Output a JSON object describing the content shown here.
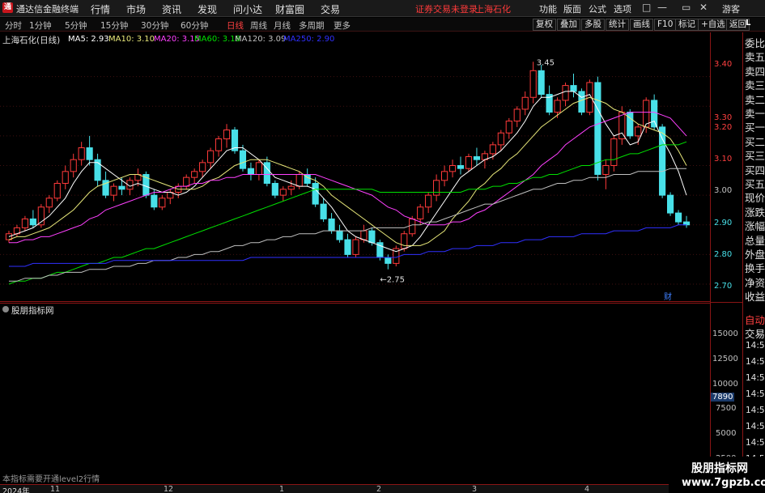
{
  "menubar": {
    "app_title": "通达信金融终端",
    "items": [
      "行情",
      "市场",
      "资讯",
      "发现",
      "问小达",
      "财富圈",
      "交易"
    ],
    "login_warning": "证券交易未登录",
    "stock_name": "上海石化",
    "right_items": [
      "功能",
      "版面",
      "公式",
      "选项"
    ],
    "guest": "游客",
    "window_controls": [
      "□",
      "—",
      "▭",
      "✕"
    ]
  },
  "toolbar": {
    "periods": [
      "分时",
      "1分钟",
      "5分钟",
      "15分钟",
      "30分钟",
      "60分钟",
      "日线",
      "周线",
      "月线",
      "多周期",
      "更多"
    ],
    "active_period": "日线",
    "buttons": [
      "复权",
      "叠加",
      "多股",
      "统计",
      "画线",
      "F10",
      "标记",
      "+自选",
      "返回"
    ]
  },
  "main_chart": {
    "title": "上海石化(日线)",
    "ma_labels": [
      {
        "text": "MA5: 2.93",
        "color": "#ffffff"
      },
      {
        "text": "MA10: 3.10",
        "color": "#e8e87a"
      },
      {
        "text": "MA20: 3.15",
        "color": "#ff40ff"
      },
      {
        "text": "MA60: 3.18",
        "color": "#00e000"
      },
      {
        "text": "MA120: 3.09",
        "color": "#c0c0c0"
      },
      {
        "text": "MA250: 2.90",
        "color": "#3030ff"
      }
    ],
    "high_label": "3.45",
    "low_label": "2.75",
    "y_ticks": [
      "3.40",
      "3.30",
      "3.20",
      "3.10",
      "3.00",
      "2.90",
      "2.80",
      "2.70"
    ],
    "fin_marker": "财"
  },
  "sub_chart": {
    "title": "股朋指标网",
    "y_ticks": [
      "15000",
      "12500",
      "10000",
      "7500",
      "5000",
      "2500"
    ],
    "current_value": "7890",
    "notice": "本指标需要开通level2行情"
  },
  "side_panel": {
    "rows": [
      "委比",
      "卖五",
      "卖四",
      "卖三",
      "卖二",
      "卖一",
      "买一",
      "买二",
      "买三",
      "买四",
      "买五",
      "现价",
      "涨跌",
      "涨幅",
      "总量",
      "外盘",
      "换手",
      "净资",
      "收益"
    ],
    "lower_rows": [
      "自动",
      "交易"
    ],
    "times": [
      "14:56",
      "14:56",
      "14:56",
      "14:56",
      "14:56",
      "14:56",
      "14:56",
      "14:56",
      "14:56",
      "14:56"
    ],
    "top_tag": "L"
  },
  "bottom_axis": {
    "labels": [
      "2024年",
      "11",
      "12",
      "1",
      "2",
      "3",
      "4"
    ]
  },
  "watermark": {
    "title": "股朋指标网",
    "url": "www.7gpzb.com"
  },
  "colors": {
    "up": "#ff3a3a",
    "down": "#48e0e8",
    "ma5": "#ffffff",
    "ma10": "#e8e87a",
    "ma20": "#ff40ff",
    "ma60": "#00e000",
    "ma120": "#c0c0c0",
    "ma250": "#3030ff"
  },
  "chart_data": {
    "type": "candlestick",
    "title": "上海石化(日线)",
    "y_range": [
      2.67,
      3.5
    ],
    "y_ticks": [
      3.4,
      3.3,
      3.2,
      3.1,
      3.0,
      2.9,
      2.8,
      2.7
    ],
    "candles": [
      [
        2.85,
        2.88,
        2.84,
        2.87
      ],
      [
        2.87,
        2.9,
        2.86,
        2.89
      ],
      [
        2.89,
        2.93,
        2.88,
        2.92
      ],
      [
        2.92,
        2.95,
        2.89,
        2.9
      ],
      [
        2.9,
        2.97,
        2.89,
        2.96
      ],
      [
        2.96,
        3.0,
        2.94,
        2.99
      ],
      [
        2.99,
        3.05,
        2.98,
        3.04
      ],
      [
        3.04,
        3.1,
        3.02,
        3.08
      ],
      [
        3.08,
        3.14,
        3.06,
        3.12
      ],
      [
        3.12,
        3.18,
        3.1,
        3.16
      ],
      [
        3.16,
        3.2,
        3.1,
        3.12
      ],
      [
        3.12,
        3.14,
        3.03,
        3.05
      ],
      [
        3.05,
        3.08,
        2.99,
        3.0
      ],
      [
        3.0,
        3.04,
        2.98,
        3.03
      ],
      [
        3.03,
        3.06,
        3.0,
        3.02
      ],
      [
        3.02,
        3.06,
        3.0,
        3.05
      ],
      [
        3.05,
        3.09,
        3.03,
        3.07
      ],
      [
        3.07,
        3.08,
        2.99,
        3.0
      ],
      [
        3.0,
        3.02,
        2.95,
        2.96
      ],
      [
        2.96,
        3.0,
        2.95,
        2.99
      ],
      [
        2.99,
        3.02,
        2.97,
        3.01
      ],
      [
        3.01,
        3.04,
        2.99,
        3.03
      ],
      [
        3.03,
        3.07,
        3.02,
        3.06
      ],
      [
        3.06,
        3.09,
        3.04,
        3.08
      ],
      [
        3.08,
        3.12,
        3.06,
        3.11
      ],
      [
        3.11,
        3.16,
        3.09,
        3.15
      ],
      [
        3.15,
        3.2,
        3.13,
        3.19
      ],
      [
        3.19,
        3.24,
        3.16,
        3.22
      ],
      [
        3.22,
        3.23,
        3.14,
        3.15
      ],
      [
        3.15,
        3.17,
        3.08,
        3.09
      ],
      [
        3.09,
        3.11,
        3.05,
        3.07
      ],
      [
        3.07,
        3.12,
        3.05,
        3.11
      ],
      [
        3.11,
        3.13,
        3.03,
        3.04
      ],
      [
        3.04,
        3.05,
        2.99,
        3.0
      ],
      [
        3.0,
        3.03,
        2.98,
        3.02
      ],
      [
        3.02,
        3.05,
        3.0,
        3.03
      ],
      [
        3.03,
        3.08,
        3.02,
        3.07
      ],
      [
        3.07,
        3.09,
        3.03,
        3.04
      ],
      [
        3.04,
        3.06,
        2.96,
        2.97
      ],
      [
        2.97,
        2.99,
        2.91,
        2.92
      ],
      [
        2.92,
        2.94,
        2.87,
        2.88
      ],
      [
        2.88,
        2.9,
        2.84,
        2.85
      ],
      [
        2.85,
        2.87,
        2.79,
        2.8
      ],
      [
        2.8,
        2.86,
        2.79,
        2.85
      ],
      [
        2.85,
        2.9,
        2.84,
        2.88
      ],
      [
        2.88,
        2.89,
        2.83,
        2.84
      ],
      [
        2.84,
        2.85,
        2.78,
        2.79
      ],
      [
        2.79,
        2.8,
        2.75,
        2.77
      ],
      [
        2.77,
        2.83,
        2.76,
        2.82
      ],
      [
        2.82,
        2.88,
        2.81,
        2.87
      ],
      [
        2.87,
        2.93,
        2.86,
        2.92
      ],
      [
        2.92,
        2.97,
        2.9,
        2.96
      ],
      [
        2.96,
        3.01,
        2.94,
        3.0
      ],
      [
        3.0,
        3.07,
        2.98,
        3.05
      ],
      [
        3.05,
        3.1,
        3.03,
        3.08
      ],
      [
        3.08,
        3.12,
        3.06,
        3.1
      ],
      [
        3.1,
        3.13,
        3.07,
        3.09
      ],
      [
        3.09,
        3.14,
        3.08,
        3.13
      ],
      [
        3.13,
        3.16,
        3.1,
        3.12
      ],
      [
        3.12,
        3.15,
        3.09,
        3.14
      ],
      [
        3.14,
        3.18,
        3.12,
        3.17
      ],
      [
        3.17,
        3.22,
        3.15,
        3.21
      ],
      [
        3.21,
        3.26,
        3.19,
        3.25
      ],
      [
        3.25,
        3.3,
        3.23,
        3.29
      ],
      [
        3.29,
        3.35,
        3.27,
        3.33
      ],
      [
        3.33,
        3.45,
        3.31,
        3.42
      ],
      [
        3.42,
        3.44,
        3.33,
        3.34
      ],
      [
        3.34,
        3.37,
        3.27,
        3.28
      ],
      [
        3.28,
        3.33,
        3.26,
        3.32
      ],
      [
        3.32,
        3.38,
        3.3,
        3.37
      ],
      [
        3.37,
        3.41,
        3.33,
        3.35
      ],
      [
        3.35,
        3.36,
        3.27,
        3.28
      ],
      [
        3.28,
        3.39,
        3.27,
        3.38
      ],
      [
        3.38,
        3.4,
        3.05,
        3.07
      ],
      [
        3.07,
        3.12,
        3.02,
        3.1
      ],
      [
        3.1,
        3.2,
        3.08,
        3.19
      ],
      [
        3.19,
        3.3,
        3.17,
        3.28
      ],
      [
        3.28,
        3.29,
        3.19,
        3.2
      ],
      [
        3.2,
        3.24,
        3.17,
        3.23
      ],
      [
        3.23,
        3.33,
        3.21,
        3.32
      ],
      [
        3.32,
        3.34,
        3.22,
        3.23
      ],
      [
        3.23,
        3.24,
        2.99,
        3.0
      ],
      [
        3.0,
        3.01,
        2.93,
        2.94
      ],
      [
        2.94,
        2.95,
        2.9,
        2.91
      ],
      [
        2.91,
        2.93,
        2.89,
        2.9
      ]
    ],
    "series": [
      {
        "name": "MA5",
        "values": [
          2.86,
          2.87,
          2.88,
          2.89,
          2.91,
          2.93,
          2.96,
          2.99,
          3.04,
          3.08,
          3.11,
          3.11,
          3.09,
          3.07,
          3.05,
          3.03,
          3.04,
          3.03,
          3.02,
          3.01,
          3.01,
          3.0,
          3.01,
          3.03,
          3.06,
          3.09,
          3.12,
          3.15,
          3.16,
          3.16,
          3.14,
          3.12,
          3.09,
          3.06,
          3.05,
          3.04,
          3.03,
          3.03,
          3.02,
          2.99,
          2.96,
          2.92,
          2.88,
          2.86,
          2.85,
          2.84,
          2.83,
          2.82,
          2.81,
          2.82,
          2.83,
          2.86,
          2.9,
          2.94,
          2.98,
          3.02,
          3.06,
          3.08,
          3.1,
          3.12,
          3.13,
          3.15,
          3.18,
          3.21,
          3.25,
          3.3,
          3.33,
          3.33,
          3.34,
          3.35,
          3.35,
          3.33,
          3.34,
          3.29,
          3.24,
          3.2,
          3.21,
          3.17,
          3.18,
          3.24,
          3.25,
          3.19,
          3.14,
          3.08,
          3.0
        ]
      },
      {
        "name": "MA10",
        "values": [
          2.85,
          2.86,
          2.86,
          2.87,
          2.88,
          2.89,
          2.91,
          2.93,
          2.95,
          2.98,
          3.01,
          3.03,
          3.04,
          3.05,
          3.06,
          3.07,
          3.07,
          3.06,
          3.05,
          3.04,
          3.03,
          3.02,
          3.02,
          3.02,
          3.03,
          3.05,
          3.06,
          3.08,
          3.1,
          3.11,
          3.12,
          3.12,
          3.12,
          3.11,
          3.1,
          3.09,
          3.08,
          3.06,
          3.05,
          3.03,
          3.0,
          2.98,
          2.96,
          2.94,
          2.92,
          2.9,
          2.88,
          2.86,
          2.84,
          2.83,
          2.83,
          2.83,
          2.84,
          2.86,
          2.88,
          2.92,
          2.95,
          2.98,
          3.02,
          3.04,
          3.07,
          3.09,
          3.12,
          3.14,
          3.17,
          3.2,
          3.23,
          3.25,
          3.27,
          3.29,
          3.31,
          3.32,
          3.33,
          3.32,
          3.31,
          3.29,
          3.28,
          3.26,
          3.24,
          3.23,
          3.22,
          3.21,
          3.19,
          3.15,
          3.1
        ]
      },
      {
        "name": "MA20",
        "values": [
          2.84,
          2.84,
          2.85,
          2.85,
          2.86,
          2.86,
          2.87,
          2.88,
          2.89,
          2.9,
          2.92,
          2.93,
          2.95,
          2.96,
          2.97,
          2.98,
          2.99,
          3.0,
          3.01,
          3.01,
          3.02,
          3.03,
          3.03,
          3.04,
          3.04,
          3.05,
          3.05,
          3.06,
          3.06,
          3.07,
          3.07,
          3.07,
          3.07,
          3.07,
          3.07,
          3.07,
          3.07,
          3.07,
          3.07,
          3.06,
          3.05,
          3.04,
          3.03,
          3.02,
          3.01,
          3.0,
          2.98,
          2.96,
          2.95,
          2.93,
          2.92,
          2.91,
          2.9,
          2.9,
          2.9,
          2.91,
          2.91,
          2.92,
          2.94,
          2.95,
          2.97,
          2.99,
          3.01,
          3.03,
          3.05,
          3.07,
          3.1,
          3.12,
          3.14,
          3.17,
          3.19,
          3.21,
          3.23,
          3.24,
          3.25,
          3.26,
          3.27,
          3.28,
          3.28,
          3.28,
          3.28,
          3.27,
          3.26,
          3.23,
          3.2
        ]
      },
      {
        "name": "MA60",
        "values": [
          2.7,
          2.71,
          2.71,
          2.72,
          2.72,
          2.73,
          2.74,
          2.74,
          2.75,
          2.76,
          2.77,
          2.77,
          2.78,
          2.79,
          2.79,
          2.8,
          2.81,
          2.82,
          2.82,
          2.83,
          2.84,
          2.85,
          2.86,
          2.87,
          2.88,
          2.89,
          2.9,
          2.91,
          2.92,
          2.93,
          2.94,
          2.95,
          2.96,
          2.97,
          2.98,
          2.99,
          3.0,
          3.01,
          3.02,
          3.02,
          3.02,
          3.02,
          3.02,
          3.02,
          3.02,
          3.02,
          3.01,
          3.01,
          3.01,
          3.01,
          3.01,
          3.01,
          3.01,
          3.01,
          3.01,
          3.01,
          3.01,
          3.02,
          3.02,
          3.02,
          3.03,
          3.03,
          3.04,
          3.04,
          3.05,
          3.06,
          3.06,
          3.07,
          3.07,
          3.08,
          3.09,
          3.1,
          3.1,
          3.11,
          3.12,
          3.12,
          3.13,
          3.14,
          3.14,
          3.15,
          3.16,
          3.17,
          3.17,
          3.17,
          3.18
        ]
      },
      {
        "name": "MA120",
        "values": [
          2.71,
          2.71,
          2.72,
          2.72,
          2.72,
          2.73,
          2.73,
          2.74,
          2.74,
          2.74,
          2.75,
          2.75,
          2.75,
          2.76,
          2.76,
          2.76,
          2.77,
          2.77,
          2.78,
          2.78,
          2.78,
          2.79,
          2.79,
          2.8,
          2.8,
          2.81,
          2.81,
          2.82,
          2.83,
          2.83,
          2.84,
          2.84,
          2.85,
          2.85,
          2.86,
          2.86,
          2.87,
          2.87,
          2.87,
          2.88,
          2.88,
          2.88,
          2.88,
          2.88,
          2.88,
          2.89,
          2.89,
          2.89,
          2.89,
          2.89,
          2.9,
          2.9,
          2.91,
          2.91,
          2.92,
          2.93,
          2.94,
          2.95,
          2.96,
          2.97,
          2.97,
          2.98,
          2.99,
          3.0,
          3.01,
          3.02,
          3.02,
          3.03,
          3.04,
          3.04,
          3.05,
          3.05,
          3.06,
          3.06,
          3.06,
          3.07,
          3.07,
          3.07,
          3.08,
          3.08,
          3.08,
          3.08,
          3.09,
          3.09,
          3.09
        ]
      },
      {
        "name": "MA250",
        "values": [
          2.76,
          2.76,
          2.76,
          2.77,
          2.77,
          2.77,
          2.77,
          2.77,
          2.77,
          2.77,
          2.77,
          2.77,
          2.77,
          2.78,
          2.78,
          2.78,
          2.78,
          2.78,
          2.78,
          2.78,
          2.78,
          2.78,
          2.78,
          2.78,
          2.78,
          2.78,
          2.78,
          2.78,
          2.78,
          2.78,
          2.79,
          2.79,
          2.79,
          2.79,
          2.79,
          2.79,
          2.79,
          2.79,
          2.79,
          2.79,
          2.79,
          2.79,
          2.79,
          2.79,
          2.79,
          2.79,
          2.79,
          2.79,
          2.79,
          2.8,
          2.8,
          2.8,
          2.81,
          2.81,
          2.81,
          2.82,
          2.82,
          2.82,
          2.83,
          2.83,
          2.83,
          2.84,
          2.84,
          2.84,
          2.85,
          2.85,
          2.85,
          2.86,
          2.86,
          2.86,
          2.86,
          2.87,
          2.87,
          2.87,
          2.87,
          2.88,
          2.88,
          2.88,
          2.88,
          2.89,
          2.89,
          2.89,
          2.89,
          2.9,
          2.9
        ]
      }
    ]
  }
}
